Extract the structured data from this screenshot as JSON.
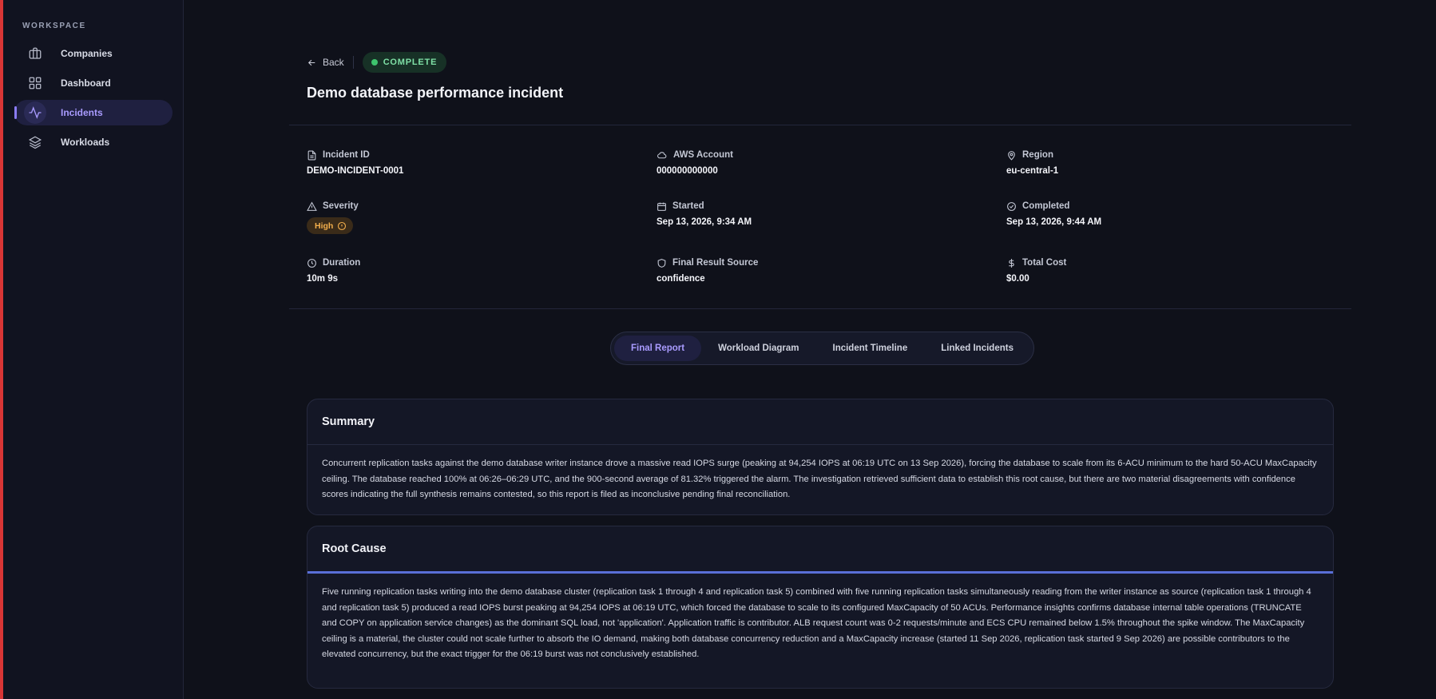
{
  "sidebar": {
    "section_label": "WORKSPACE",
    "items": [
      {
        "label": "Companies",
        "icon": "briefcase-icon",
        "active": false
      },
      {
        "label": "Dashboard",
        "icon": "grid-icon",
        "active": false
      },
      {
        "label": "Incidents",
        "icon": "activity-icon",
        "active": true
      },
      {
        "label": "Workloads",
        "icon": "layers-icon",
        "active": false
      }
    ]
  },
  "header": {
    "back_label": "Back",
    "status": "COMPLETE",
    "title": "Demo database performance incident"
  },
  "meta": {
    "incident_id": {
      "label": "Incident ID",
      "value": "DEMO-INCIDENT-0001"
    },
    "aws_account": {
      "label": "AWS Account",
      "value": "000000000000"
    },
    "region": {
      "label": "Region",
      "value": "eu-central-1"
    },
    "severity": {
      "label": "Severity",
      "value": "High"
    },
    "started": {
      "label": "Started",
      "value": "Sep 13, 2026, 9:34 AM"
    },
    "completed": {
      "label": "Completed",
      "value": "Sep 13, 2026, 9:44 AM"
    },
    "duration": {
      "label": "Duration",
      "value": "10m 9s"
    },
    "final_result_source": {
      "label": "Final Result Source",
      "value": "confidence"
    },
    "total_cost": {
      "label": "Total Cost",
      "value": "$0.00"
    }
  },
  "tabs": [
    {
      "label": "Final Report",
      "active": true
    },
    {
      "label": "Workload Diagram",
      "active": false
    },
    {
      "label": "Incident Timeline",
      "active": false
    },
    {
      "label": "Linked Incidents",
      "active": false
    }
  ],
  "summary": {
    "title": "Summary",
    "text": "Concurrent replication tasks against the demo database writer instance drove a massive read IOPS surge (peaking at 94,254 IOPS at 06:19 UTC on 13 Sep 2026), forcing the database to scale from its 6-ACU minimum to the hard 50-ACU MaxCapacity ceiling. The database reached 100% at 06:26–06:29 UTC, and the 900-second average of 81.32% triggered the alarm. The investigation retrieved sufficient data to establish this root cause, but there are two material disagreements with confidence scores indicating the full synthesis remains contested, so this report is filed as inconclusive pending final reconciliation."
  },
  "root_cause": {
    "title": "Root Cause",
    "text": "Five running replication tasks writing into the demo database cluster (replication task 1 through 4 and replication task 5) combined with five running replication tasks simultaneously reading from the writer instance as source (replication task 1 through 4 and replication task 5) produced a read IOPS burst peaking at 94,254 IOPS at 06:19 UTC, which forced the database to scale to its configured MaxCapacity of 50 ACUs. Performance insights confirms database internal table operations (TRUNCATE and COPY on application service changes) as the dominant SQL load, not 'application'. Application traffic is contributor. ALB request count was 0-2 requests/minute and ECS CPU remained below 1.5% throughout the spike window. The MaxCapacity ceiling is a material, the cluster could not scale further to absorb the IO demand, making both database concurrency reduction and a MaxCapacity increase (started 11 Sep 2026, replication task started 9 Sep 2026) are possible contributors to the elevated concurrency, but the exact trigger for the 06:19 burst was not conclusively established."
  },
  "colors": {
    "accent": "#a99bff",
    "success": "#3ec46d",
    "warning": "#f2ae4c",
    "alert_edge": "#d93636"
  }
}
